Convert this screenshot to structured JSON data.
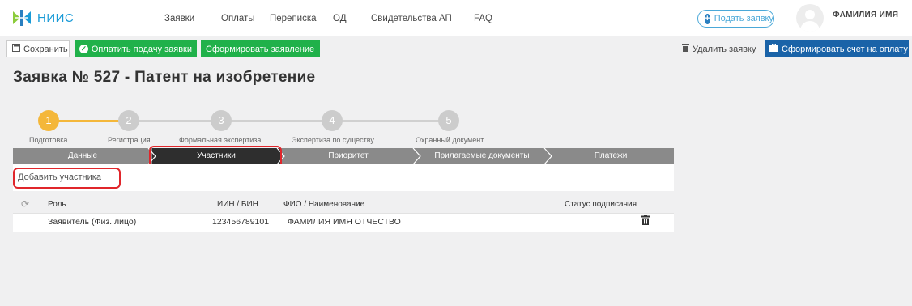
{
  "brand": {
    "name": "НИИС",
    "accent": "#1a9bd7"
  },
  "nav": {
    "items": [
      "Заявки",
      "Оплаты",
      "Переписка",
      "ОД",
      "Свидетельства АП",
      "FAQ"
    ],
    "submit_label": "Подать заявку",
    "user_name": "ФАМИЛИЯ ИМЯ"
  },
  "toolbar": {
    "save_label": "Сохранить",
    "pay_label": "Оплатить подачу заявки",
    "form_statement_label": "Сформировать заявление",
    "delete_label": "Удалить заявку",
    "invoice_label": "Сформировать счет на оплату"
  },
  "page": {
    "title": "Заявка № 527 - Патент на изобретение"
  },
  "stepper": {
    "steps": [
      {
        "num": "1",
        "label": "Подготовка",
        "active": true
      },
      {
        "num": "2",
        "label": "Регистрация",
        "active": false
      },
      {
        "num": "3",
        "label": "Формальная экспертиза",
        "active": false
      },
      {
        "num": "4",
        "label": "Экспертиза по существу",
        "active": false
      },
      {
        "num": "5",
        "label": "Охранный документ",
        "active": false
      }
    ]
  },
  "tabs": {
    "items": [
      "Данные",
      "Участники",
      "Приоритет",
      "Прилагаемые документы",
      "Платежи"
    ],
    "active_index": 1
  },
  "participants": {
    "add_label": "Добавить участника",
    "columns": [
      "Роль",
      "ИИН / БИН",
      "ФИО / Наименование",
      "Статус подписания"
    ],
    "rows": [
      {
        "role": "Заявитель (Физ. лицо)",
        "iin": "123456789101",
        "name": "ФАМИЛИЯ ИМЯ ОТЧЕСТВО",
        "status": ""
      }
    ]
  },
  "colors": {
    "green": "#20b14a",
    "blue": "#1a63a8",
    "step_active": "#f4b73a",
    "tab_active": "#2e2e2e",
    "highlight": "#e0262b"
  }
}
